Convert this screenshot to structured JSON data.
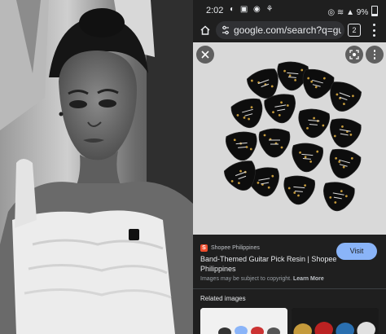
{
  "status": {
    "time": "2:02",
    "left_icons": "◐ ▣ ◉ ⚘",
    "right_icons": "◎ ≋ ▲",
    "battery": "9%"
  },
  "browser": {
    "url": "google.com/search?q=guitar",
    "tab_count": "2"
  },
  "image_viewer": {
    "close_icon": "close-icon",
    "lens_icon": "lens-icon",
    "more_icon": "more-vert-icon",
    "picks": [
      "KoRn",
      "Avenged Sevenfold",
      "Green Day",
      "The Beatles",
      "Sleeping with Sirens",
      "Slipknot",
      "Linkin Park",
      "AC/DC"
    ]
  },
  "result": {
    "source_name": "Shopee Philippines",
    "source_logo": "S",
    "title": "Band-Themed Guitar Pick Resin | Shopee Philippines",
    "copyright": "Images may be subject to copyright.",
    "learn_more": "Learn More",
    "visit_label": "Visit"
  },
  "related": {
    "heading": "Related images"
  },
  "colors": {
    "accent": "#8ab4f8",
    "background": "#1f1f1f",
    "shopee": "#ee4d2d"
  }
}
